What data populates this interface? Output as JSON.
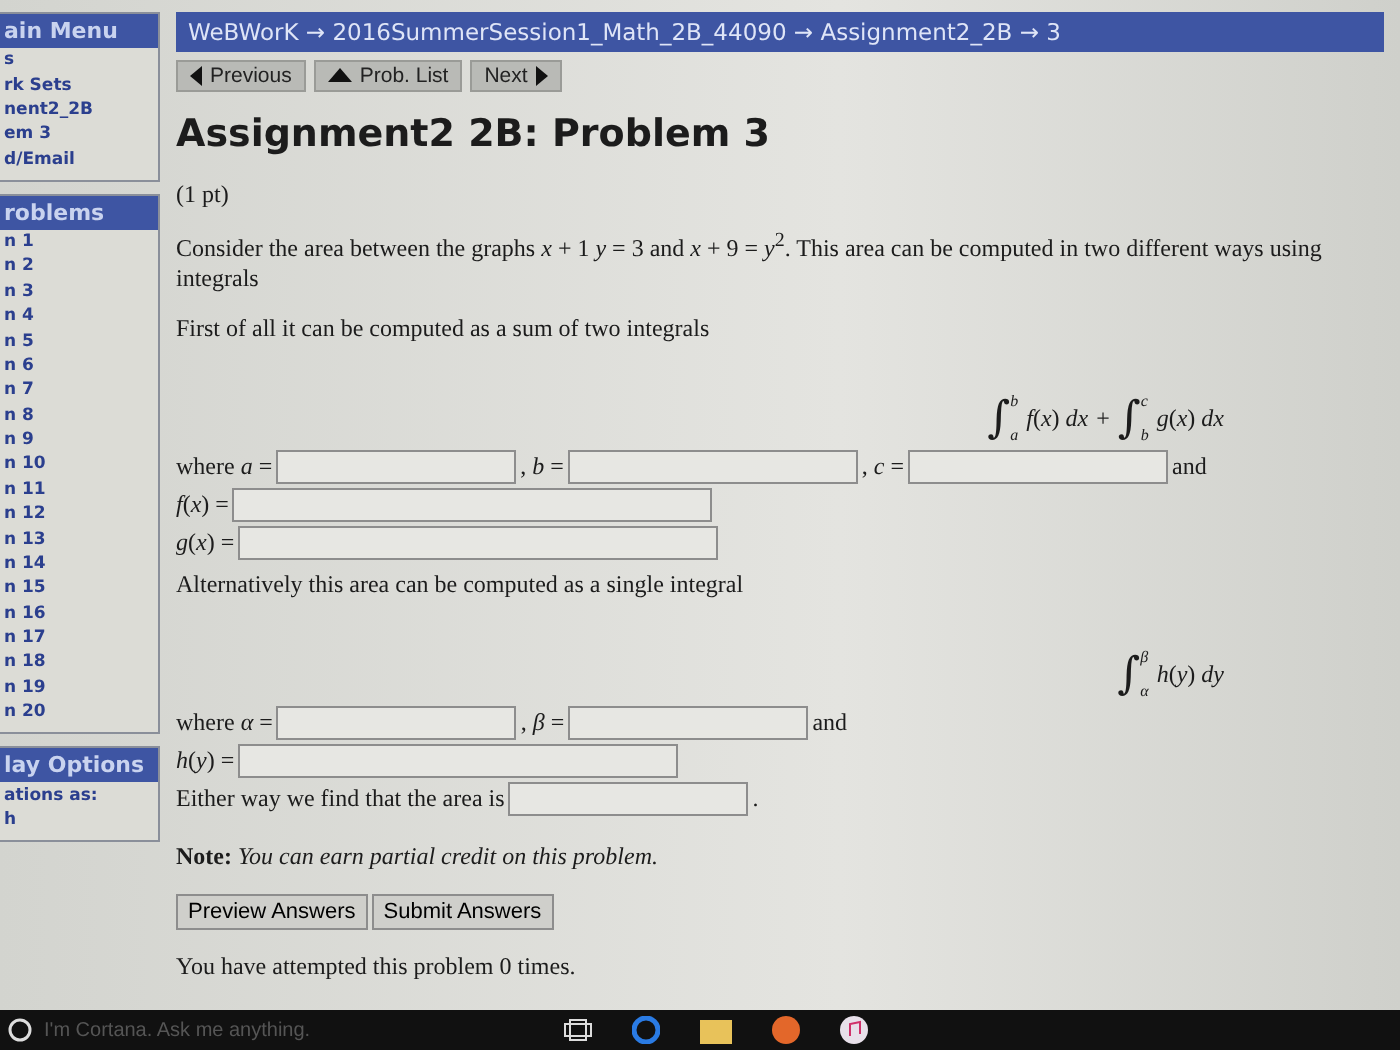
{
  "sidebar": {
    "sections": [
      {
        "title": "ain Menu",
        "items": [
          "s",
          "rk Sets",
          "nent2_2B",
          "em 3",
          "d/Email"
        ]
      },
      {
        "title": "roblems",
        "items": [
          "n 1",
          "n 2",
          "n 3",
          "n 4",
          "n 5",
          "n 6",
          "n 7",
          "n 8",
          "n 9",
          "n 10",
          "n 11",
          "n 12",
          "n 13",
          "n 14",
          "n 15",
          "n 16",
          "n 17",
          "n 18",
          "n 19",
          "n 20"
        ]
      },
      {
        "title": "lay Options",
        "items": [
          "ations as:",
          "h"
        ]
      }
    ]
  },
  "breadcrumb": "WeBWorK → 2016SummerSession1_Math_2B_44090 → Assignment2_2B → 3",
  "nav": [
    {
      "label": "Previous",
      "kind": "left"
    },
    {
      "label": "Prob. List",
      "kind": "up"
    },
    {
      "label": "Next",
      "kind": "right"
    }
  ],
  "title": "Assignment2 2B: Problem 3",
  "points": "(1 pt)",
  "intro": "Consider the area between the graphs *x* + 1 *y* = 3 and *x* + 9 = *y*$^{2}$. This area can be computed in two different ways using integrals",
  "part1": "First of all it can be computed as a sum of two integrals",
  "integral1": {
    "terms": [
      {
        "sign": "∫",
        "lower": "a",
        "upper": "b",
        "integrand": "*f*(*x*) *dx*"
      },
      {
        "sign": "∫",
        "lower": "b",
        "upper": "c",
        "integrand": "*g*(*x*) *dx*"
      }
    ],
    "joiner": "+"
  },
  "row1": {
    "blanks": [
      {
        "label": "where *a* ="
      },
      {
        "label": ", *b* ="
      },
      {
        "label": ", *c* ="
      }
    ],
    "suffix": "and"
  },
  "functions1": [
    "*f*(*x*) =",
    "*g*(*x*) ="
  ],
  "part2": "Alternatively this area can be computed as a single integral",
  "integral2": {
    "terms": [
      {
        "sign": "∫",
        "lower": "α",
        "upper": "β",
        "integrand": "*h*(*y*) *dy*"
      }
    ]
  },
  "row2": {
    "blanks": [
      {
        "label": "where *α* ="
      },
      {
        "label": ", *β* ="
      }
    ],
    "suffix": "and"
  },
  "functions2": [
    "*h*(*y*) ="
  ],
  "area": {
    "label": "Either way we find that the area is",
    "suffix": "."
  },
  "note": "**Note:** *You can earn partial credit on this problem.*",
  "buttons": [
    "Preview Answers",
    "Submit Answers"
  ],
  "attempts": "You have attempted this problem 0 times.",
  "taskbar": {
    "search_placeholder": "I'm Cortana. Ask me anything."
  }
}
